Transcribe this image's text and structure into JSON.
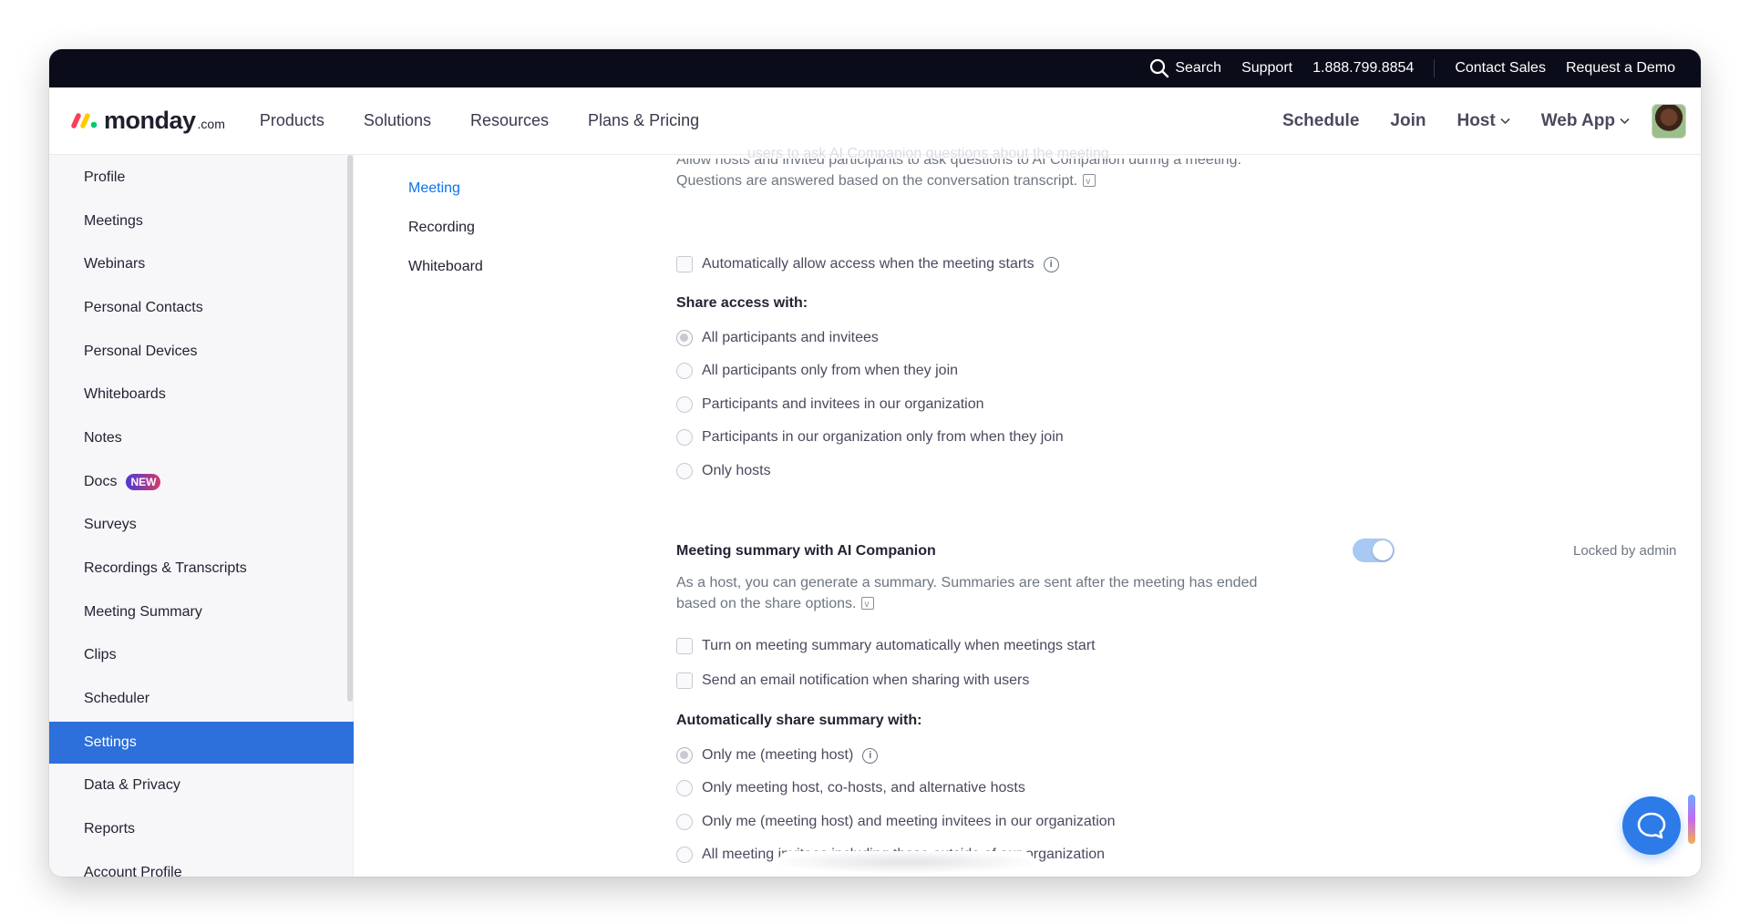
{
  "topbar": {
    "search": "Search",
    "support": "Support",
    "phone": "1.888.799.8854",
    "contact_sales": "Contact Sales",
    "request_demo": "Request a Demo"
  },
  "brand": {
    "name": "monday",
    "suffix": ".com",
    "colors": [
      "#ff3d57",
      "#ffcb00",
      "#00ca72"
    ]
  },
  "nav": {
    "products": "Products",
    "solutions": "Solutions",
    "resources": "Resources",
    "plans": "Plans & Pricing",
    "schedule": "Schedule",
    "join": "Join",
    "host": "Host",
    "web_app": "Web App"
  },
  "faded_heading": "users to ask AI Companion questions about the meeting",
  "sidebar": {
    "items": [
      {
        "label": "Profile"
      },
      {
        "label": "Meetings"
      },
      {
        "label": "Webinars"
      },
      {
        "label": "Personal Contacts"
      },
      {
        "label": "Personal Devices"
      },
      {
        "label": "Whiteboards"
      },
      {
        "label": "Notes"
      },
      {
        "label": "Docs",
        "badge": "NEW"
      },
      {
        "label": "Surveys"
      },
      {
        "label": "Recordings & Transcripts"
      },
      {
        "label": "Meeting Summary"
      },
      {
        "label": "Clips"
      },
      {
        "label": "Scheduler"
      },
      {
        "label": "Settings",
        "active": true
      },
      {
        "label": "Data & Privacy"
      },
      {
        "label": "Reports"
      },
      {
        "label": "Account Profile"
      }
    ],
    "active_color": "#2d6fdb"
  },
  "subnav": {
    "items": [
      "Meeting",
      "Recording",
      "Whiteboard"
    ],
    "active": "Meeting"
  },
  "questions_section": {
    "desc_partial": "Allow hosts and invited participants to ask questions to AI Companion during a meeting. Questions are answered based on the conversation transcript.",
    "auto_allow": "Automatically allow access when the meeting starts",
    "share_heading": "Share access with:",
    "share_options": [
      "All participants and invitees",
      "All participants only from when they join",
      "Participants and invitees in our organization",
      "Participants in our organization only from when they join",
      "Only hosts"
    ]
  },
  "summary_section": {
    "title": "Meeting summary with AI Companion",
    "locked": "Locked by admin",
    "toggle_on": true,
    "desc": "As a host, you can generate a summary. Summaries are sent after the meeting has ended based on the share options.",
    "checkbox_1": "Turn on meeting summary automatically when meetings start",
    "checkbox_2": "Send an email notification when sharing with users",
    "share_heading": "Automatically share summary with:",
    "share_options": [
      "Only me (meeting host)",
      "Only meeting host, co-hosts, and alternative hosts",
      "Only me (meeting host) and meeting invitees in our organization",
      "All meeting invitees including those outside of our organization"
    ]
  }
}
